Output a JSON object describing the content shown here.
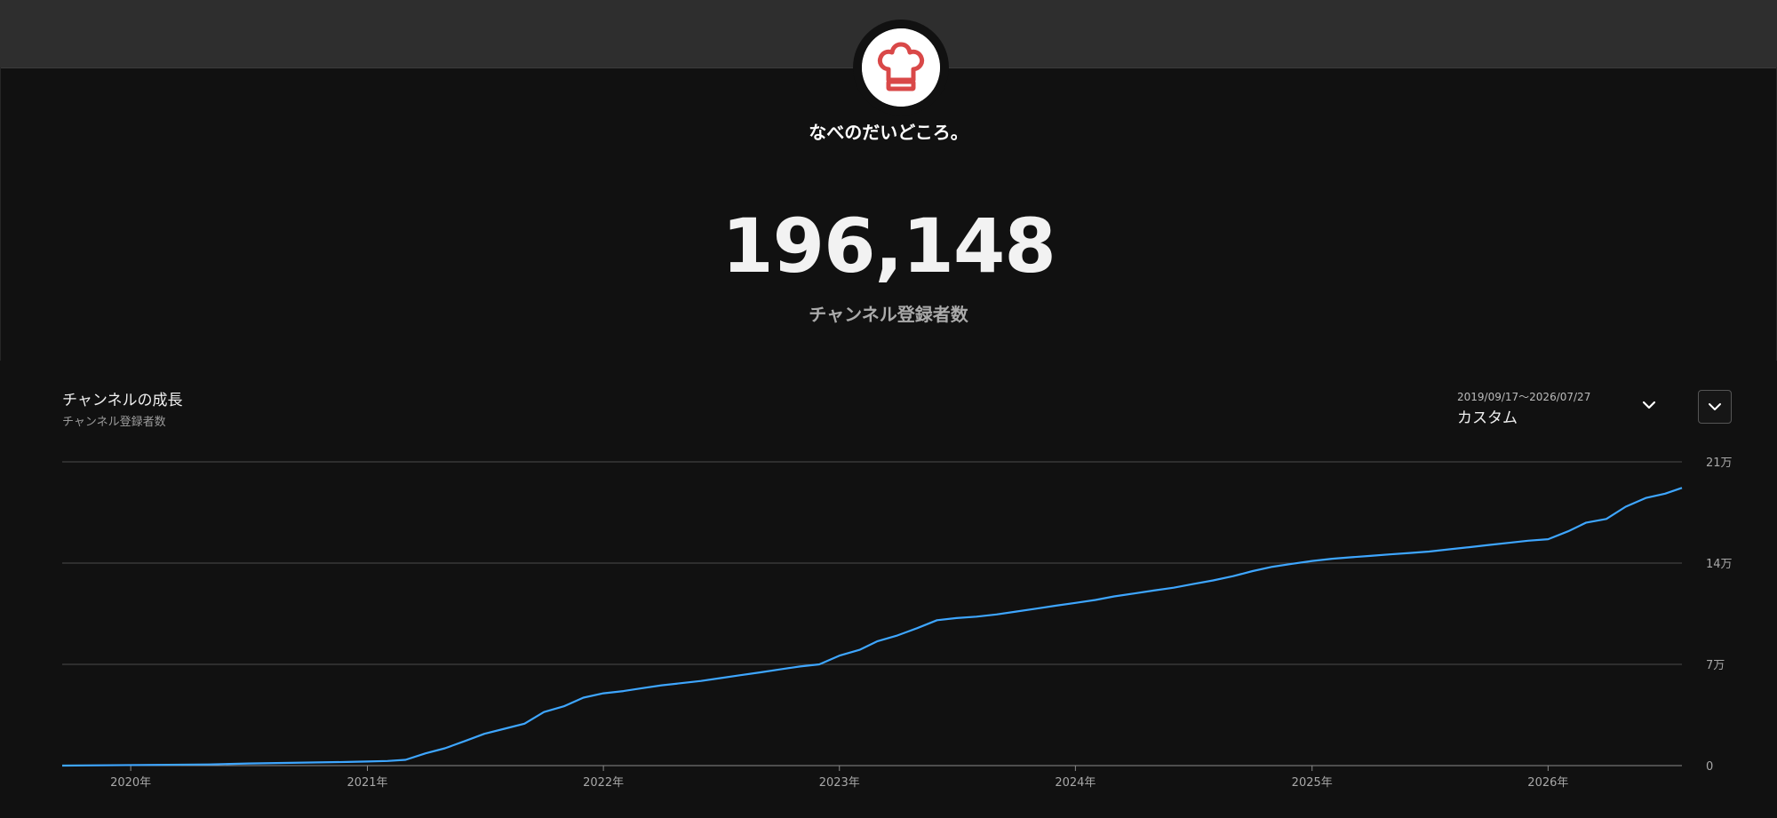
{
  "channel": {
    "name": "なべのだいどころ。",
    "avatar_icon": "chef-hat-icon",
    "subscriber_count": "196,148",
    "subscriber_label": "チャンネル登録者数"
  },
  "growth_panel": {
    "title": "チャンネルの成長",
    "subtitle": "チャンネル登録者数",
    "range_dates": "2019/09/17〜2026/07/27",
    "range_mode": "カスタム",
    "range_icon": "chevron-down-icon",
    "menu_icon": "chevron-down-icon"
  },
  "colors": {
    "background": "#111111",
    "header_band": "#2e2e2e",
    "line": "#3ea6ff",
    "accent": "#e05252"
  },
  "chart_data": {
    "type": "line",
    "title": "チャンネルの成長",
    "subtitle": "チャンネル登録者数",
    "x_tick_labels": [
      "2020年",
      "2021年",
      "2022年",
      "2023年",
      "2024年",
      "2025年",
      "2026年"
    ],
    "y_tick_labels": [
      "0",
      "7万",
      "14万",
      "21万"
    ],
    "y_ticks": [
      0,
      70000,
      140000,
      210000
    ],
    "ylim": [
      0,
      210000
    ],
    "xlim": [
      "2019-09-17",
      "2026-07-27"
    ],
    "grid": true,
    "series": [
      {
        "x": [
          "2019-09-17",
          "2020-05-01",
          "2020-07-01",
          "2020-12-01",
          "2021-01-01",
          "2021-02-01",
          "2021-03-01",
          "2021-04-01",
          "2021-05-01",
          "2021-06-01",
          "2021-07-01",
          "2021-08-01",
          "2021-09-01",
          "2021-10-01",
          "2021-11-01",
          "2021-12-01",
          "2022-01-01",
          "2022-02-01",
          "2022-03-01",
          "2022-04-01",
          "2022-05-01",
          "2022-06-01",
          "2022-07-01",
          "2022-08-01",
          "2022-09-01",
          "2022-10-01",
          "2022-11-01",
          "2022-12-01",
          "2023-01-01",
          "2023-02-01",
          "2023-03-01",
          "2023-04-01",
          "2023-05-01",
          "2023-06-01",
          "2023-07-01",
          "2023-08-01",
          "2023-09-01",
          "2023-10-01",
          "2023-11-01",
          "2023-12-01",
          "2024-01-01",
          "2024-02-01",
          "2024-03-01",
          "2024-04-01",
          "2024-05-01",
          "2024-06-01",
          "2024-07-01",
          "2024-08-01",
          "2024-09-01",
          "2024-10-01",
          "2024-11-01",
          "2024-12-01",
          "2025-01-01",
          "2025-02-01",
          "2025-03-01",
          "2025-04-01",
          "2025-05-01",
          "2025-06-01",
          "2025-07-01",
          "2025-08-01",
          "2025-09-01",
          "2025-10-01",
          "2025-11-01",
          "2025-12-01",
          "2026-01-01",
          "2026-02-01",
          "2026-03-01",
          "2026-04-01",
          "2026-05-01",
          "2026-06-01",
          "2026-07-01",
          "2026-07-27"
        ],
        "y": [
          0,
          800,
          1500,
          2500,
          2800,
          3200,
          4000,
          8500,
          12000,
          17000,
          22000,
          25500,
          29000,
          37000,
          41000,
          47000,
          50000,
          51500,
          53500,
          55500,
          57000,
          58500,
          60500,
          62500,
          64500,
          66500,
          68500,
          70000,
          76000,
          80000,
          86000,
          90000,
          95000,
          100500,
          102000,
          103000,
          104500,
          106500,
          108500,
          110500,
          112500,
          114500,
          117000,
          119000,
          121000,
          123000,
          125500,
          128000,
          131000,
          134500,
          137500,
          139500,
          141500,
          143000,
          144000,
          145000,
          146000,
          147000,
          148000,
          149500,
          151000,
          152500,
          154000,
          155500,
          156500,
          162000,
          168000,
          170500,
          179000,
          185000,
          188000,
          192000
        ]
      }
    ]
  }
}
